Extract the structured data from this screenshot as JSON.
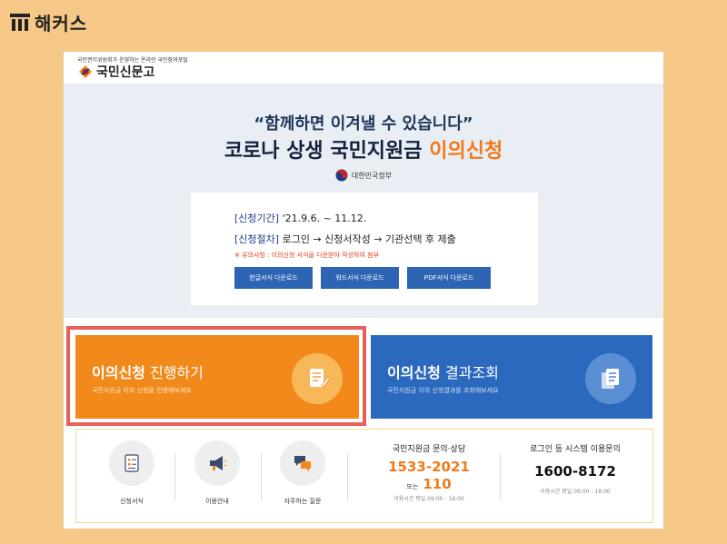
{
  "brand": {
    "name": "해커스"
  },
  "site": {
    "tagline": "국민권익위원회가 운영하는 온라인 국민참여포털",
    "logo_text": "국민신문고"
  },
  "hero": {
    "quote": "“함께하면 이겨낼 수 있습니다”",
    "title_main": "코로나 상생 국민지원금",
    "title_accent": "이의신청",
    "gov_label": "대한민국정부"
  },
  "info": {
    "period_label": "[신청기간]",
    "period_value": "'21.9.6. ~ 11.12.",
    "steps_label": "[신청절차]",
    "steps_value": "로그인 → 신청서작성 → 기관선택 후 제출",
    "notice": "※ 유의사항 : 이의신청 서식을 다운받아 작성하여 첨부",
    "downloads": [
      "한글서식 다운로드",
      "워드서식 다운로드",
      "PDF서식 다운로드"
    ]
  },
  "cards": {
    "apply": {
      "title_bold": "이의신청",
      "title_rest": " 진행하기",
      "subtitle": "국민지원금 이의 신청을 진행해보세요"
    },
    "result": {
      "title_bold": "이의신청",
      "title_rest": " 결과조회",
      "subtitle": "국민지원금 이의 신청결과를 조회해보세요"
    }
  },
  "quick_links": [
    "신청서식",
    "이용안내",
    "자주하는 질문"
  ],
  "contact1": {
    "title": "국민지원금 문의·상담",
    "phone": "1533-2021",
    "or_text": "또는",
    "phone2": "110",
    "hours": "이용시간 평일 09:00 - 18:00"
  },
  "contact2": {
    "title": "로그인 등 시스템 이용문의",
    "phone": "1600-8172",
    "hours": "이용시간 평일 09:00 - 18:00"
  },
  "colors": {
    "background": "#f6c887",
    "accent_orange": "#f2891b",
    "accent_blue": "#2a69be",
    "highlight": "#e8605a"
  }
}
